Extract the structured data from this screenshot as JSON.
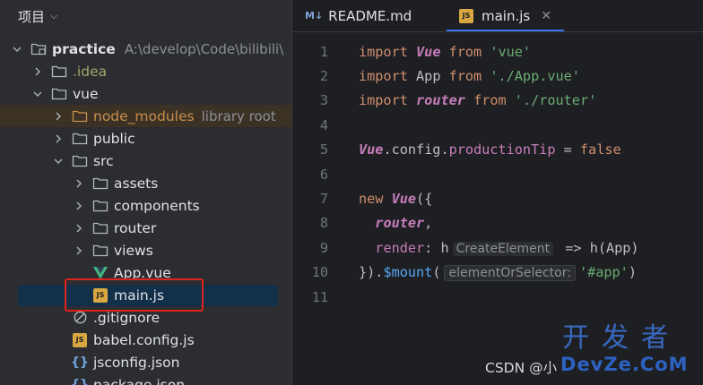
{
  "project_panel": {
    "title": "项目",
    "tree": [
      {
        "label": "practice",
        "hint": "A:\\develop\\Code\\bilibili\\"
      },
      {
        "label": ".idea"
      },
      {
        "label": "vue"
      },
      {
        "label": "node_modules",
        "hint": "library root"
      },
      {
        "label": "public"
      },
      {
        "label": "src"
      },
      {
        "label": "assets"
      },
      {
        "label": "components"
      },
      {
        "label": "router"
      },
      {
        "label": "views"
      },
      {
        "label": "App.vue"
      },
      {
        "label": "main.js"
      },
      {
        "label": ".gitignore"
      },
      {
        "label": "babel.config.js"
      },
      {
        "label": "jsconfig.json"
      },
      {
        "label": "package.json"
      }
    ]
  },
  "editor": {
    "tabs": [
      {
        "label": "README.md",
        "icon": "M↓"
      },
      {
        "label": "main.js",
        "icon": "JS",
        "close": "✕"
      }
    ],
    "line_numbers": [
      "1",
      "2",
      "3",
      "4",
      "5",
      "6",
      "7",
      "8",
      "9",
      "10",
      "11"
    ],
    "code": {
      "l1": {
        "kw": "import",
        "name": "Vue",
        "from": "from",
        "str": "'vue'"
      },
      "l2": {
        "kw": "import",
        "name": "App",
        "from": "from",
        "str": "'./App.vue'"
      },
      "l3": {
        "kw": "import",
        "name": "router",
        "from": "from",
        "str": "'./router'"
      },
      "l5": {
        "obj": "Vue",
        "rest1": ".config.",
        "prop": "productionTip",
        "op": " = ",
        "val": "false"
      },
      "l7": {
        "kw": "new",
        "cls": "Vue",
        "rest": "({"
      },
      "l8": {
        "name": "router",
        "rest": ","
      },
      "l9": {
        "prop": "render",
        "colon": ": ",
        "param": "h",
        "hint": "CreateElement",
        "arrow": " => ",
        "fn": "h",
        "args": "(App)"
      },
      "l10": {
        "close": "}).",
        "fn": "$mount",
        "open": "(",
        "hint": "elementOrSelector:",
        "str": "'#app'",
        "end": ")"
      }
    }
  },
  "watermark": {
    "csdn": "CSDN @小",
    "brand_cn": "开发者",
    "brand_en": "DevZe.CoM"
  },
  "colors": {
    "highlight_box": "#e0241c",
    "selection": "#12304a",
    "keyword": "#cf8e6d",
    "string": "#6aab73"
  }
}
